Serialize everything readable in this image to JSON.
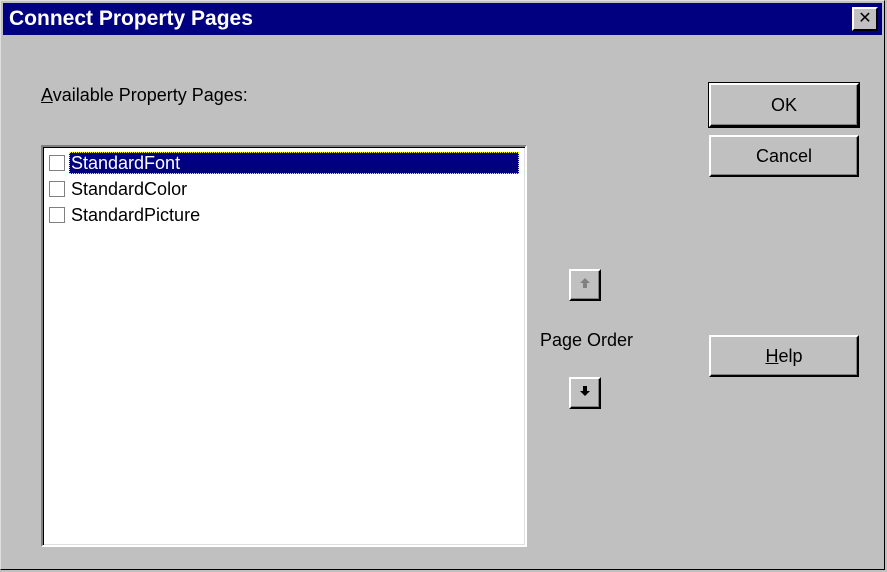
{
  "window": {
    "title": "Connect Property Pages",
    "close_glyph": "✕"
  },
  "available_label": {
    "accel": "A",
    "rest": "vailable Property Pages:"
  },
  "pages": [
    {
      "label": "StandardFont",
      "checked": false,
      "selected": true
    },
    {
      "label": "StandardColor",
      "checked": false,
      "selected": false
    },
    {
      "label": "StandardPicture",
      "checked": false,
      "selected": false
    }
  ],
  "buttons": {
    "ok": "OK",
    "cancel": "Cancel",
    "help_accel": "H",
    "help_rest": "elp"
  },
  "page_order": {
    "label": "Page Order",
    "up_icon": "arrow-up-icon",
    "down_icon": "arrow-down-icon"
  },
  "colors": {
    "titlebar": "#000080",
    "face": "#c0c0c0",
    "selection": "#000080"
  }
}
